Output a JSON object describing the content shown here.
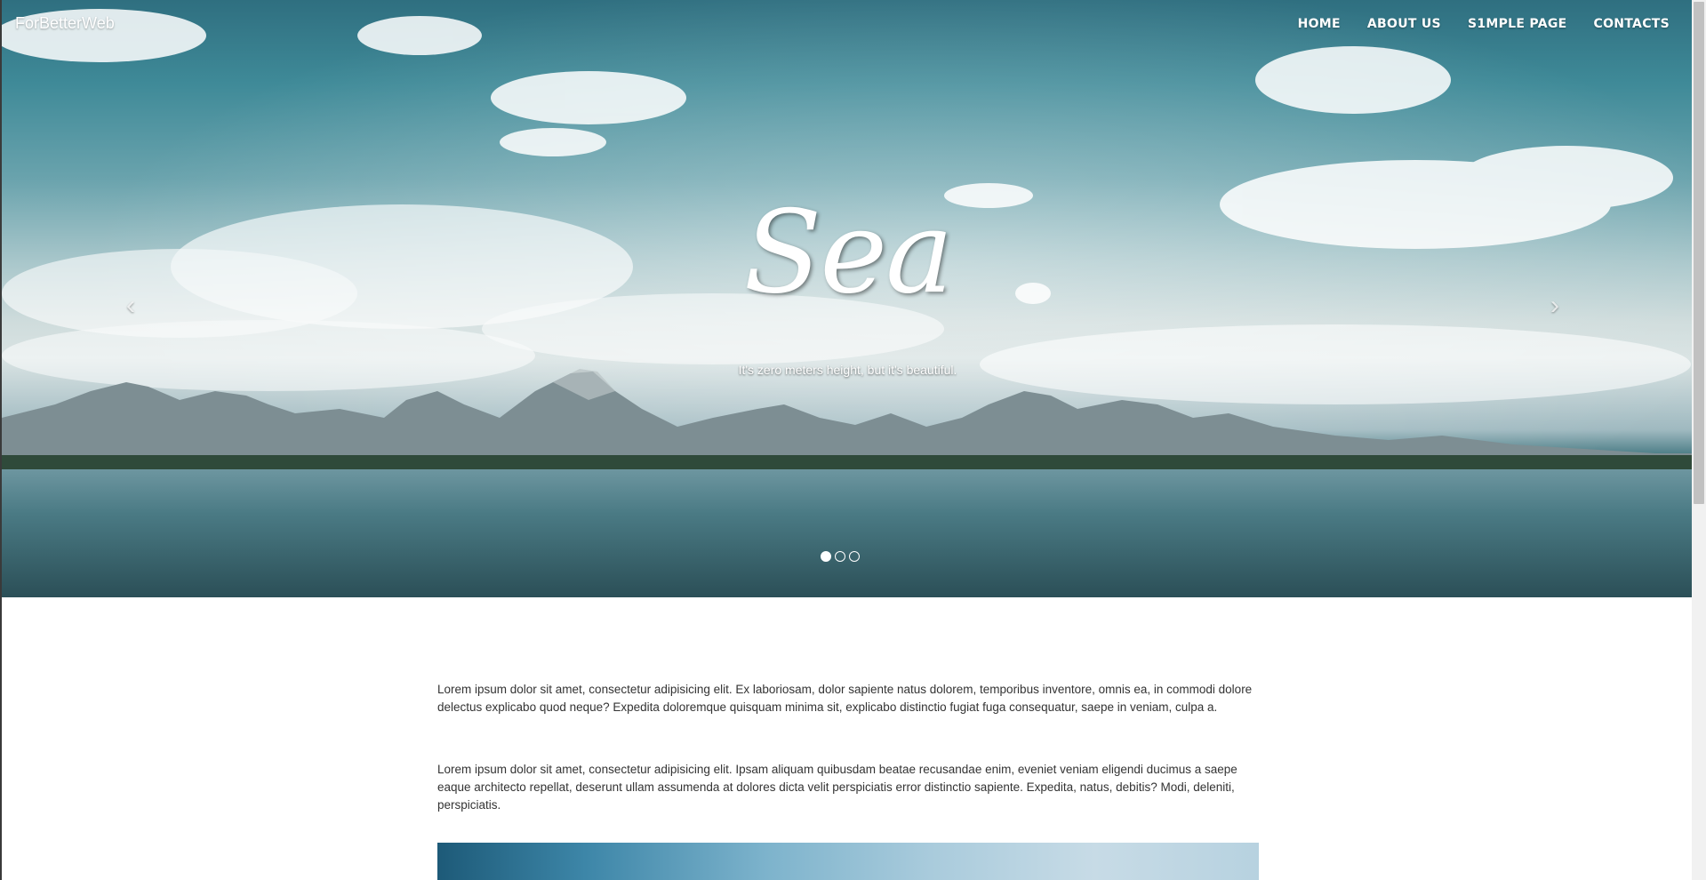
{
  "brand": "ForBetterWeb",
  "nav": {
    "items": [
      {
        "label": "HOME"
      },
      {
        "label": "ABOUT US"
      },
      {
        "label": "S1MPLE PAGE"
      },
      {
        "label": "CONTACTS"
      }
    ]
  },
  "carousel": {
    "title": "Sea",
    "caption": "It's zero meters height, but it's beautiful.",
    "prev_icon": "‹",
    "next_icon": "›",
    "slide_count": 3,
    "active_index": 0
  },
  "content": {
    "paragraphs": [
      "Lorem ipsum dolor sit amet, consectetur adipisicing elit. Ex laboriosam, dolor sapiente natus dolorem, temporibus inventore, omnis ea, in commodi dolore delectus explicabo quod neque? Expedita doloremque quisquam minima sit, explicabo distinctio fugiat fuga consequatur, saepe in veniam, culpa a.",
      "Lorem ipsum dolor sit amet, consectetur adipisicing elit. Ipsam aliquam quibusdam beatae recusandae enim, eveniet veniam eligendi ducimus a saepe eaque architecto repellat, deserunt ullam assumenda at dolores dicta velit perspiciatis error distinctio sapiente. Expedita, natus, debitis? Modi, deleniti, perspiciatis."
    ]
  },
  "colors": {
    "nav_text": "#ffffff",
    "body_text": "#333333",
    "sky": "#3f8a98",
    "water": "#2d555d"
  }
}
